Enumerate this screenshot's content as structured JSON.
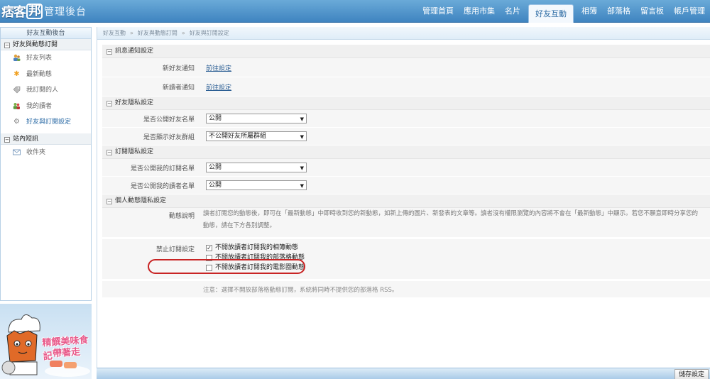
{
  "header": {
    "logo_text": "痞客",
    "logo_box_text": "邦",
    "admin_title": "管理後台",
    "nav": [
      {
        "label": "管理首頁"
      },
      {
        "label": "應用市集"
      },
      {
        "label": "名片"
      },
      {
        "label": "好友互動",
        "active": true
      },
      {
        "label": "相簿"
      },
      {
        "label": "部落格"
      },
      {
        "label": "留言板"
      },
      {
        "label": "帳戶管理"
      }
    ]
  },
  "sidebar": {
    "title": "好友互動後台",
    "sections": [
      {
        "label": "好友與動態訂閱",
        "toggle": "⊟",
        "items": [
          {
            "label": "好友列表",
            "icon": "friends-icon"
          },
          {
            "label": "最新動態",
            "icon": "star-burst-icon"
          },
          {
            "label": "我訂閱的人",
            "icon": "tag-icon"
          },
          {
            "label": "我的讀者",
            "icon": "readers-icon"
          },
          {
            "label": "好友與訂閱設定",
            "icon": "gear-icon",
            "active": true
          }
        ]
      },
      {
        "label": "站內短訊",
        "toggle": "⊟",
        "items": [
          {
            "label": "收件夾",
            "icon": "envelope-icon"
          }
        ]
      }
    ],
    "banner_line1": "精饌美味食記",
    "banner_line2": "帶著走"
  },
  "breadcrumb": [
    "好友互動",
    "好友與動態訂閱",
    "好友與訂閱設定"
  ],
  "breadcrumb_sep": "»",
  "sections": {
    "notify": {
      "title": "訊息通知設定",
      "rows": [
        {
          "label": "新好友通知",
          "link": "前往設定"
        },
        {
          "label": "新讀者通知",
          "link": "前往設定"
        }
      ]
    },
    "friend_privacy": {
      "title": "好友隱私設定",
      "rows": [
        {
          "label": "是否公開好友名單",
          "value": "公開"
        },
        {
          "label": "是否顯示好友群組",
          "value": "不公開好友所屬群組"
        }
      ]
    },
    "sub_privacy": {
      "title": "訂閱隱私設定",
      "rows": [
        {
          "label": "是否公開我的訂閱名單",
          "value": "公開"
        },
        {
          "label": "是否公開我的讀者名單",
          "value": "公開"
        }
      ]
    },
    "activity": {
      "title": "個人動態隱私設定",
      "desc_label": "動態說明",
      "desc_line1": "讀者訂閱您的動態後，即可在「最新動態」中即時收到您的新動態，如新上傳的圖片、新發表的文章等。讀者沒有權限瀏覽的內容將不會在「最新動態」中顯示。若您不願意即時分享您的",
      "desc_line2": "動態，請在下方各別調整。",
      "block_label": "禁止訂閱設定",
      "options": [
        {
          "label": "不開放讀者訂閱我的相簿動態",
          "checked": true
        },
        {
          "label": "不開放讀者訂閱我的部落格動態",
          "checked": false
        },
        {
          "label": "不開放讀者訂閱我的電影圈動態",
          "checked": false
        }
      ],
      "note": "注意：選擇不開放部落格動態訂閱，系統將同時不提供您的部落格 RSS。"
    }
  },
  "footer": {
    "save_label": "儲存設定"
  }
}
